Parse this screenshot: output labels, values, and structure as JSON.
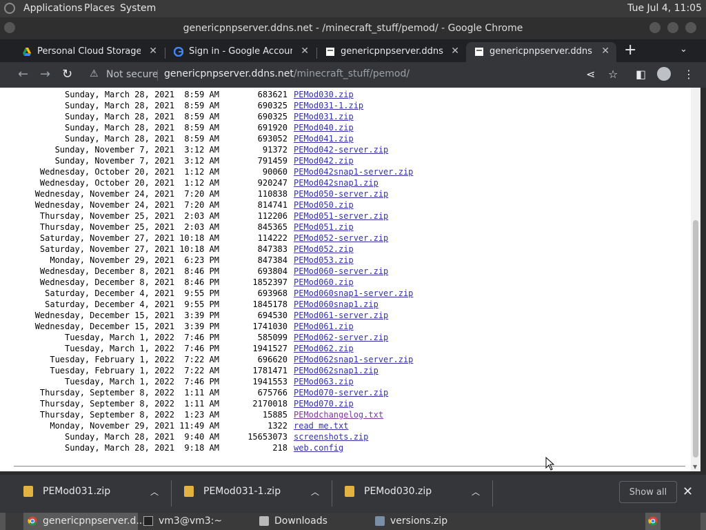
{
  "desktop": {
    "menus": [
      "Applications",
      "Places",
      "System"
    ],
    "clock": "Tue Jul  4, 11:05"
  },
  "window": {
    "title": "genericpnpserver.ddns.net - /minecraft_stuff/pemod/ - Google Chrome"
  },
  "tabs": [
    {
      "label": "Personal Cloud Storage & F",
      "icon": "google-drive-icon"
    },
    {
      "label": "Sign in - Google Accounts",
      "icon": "google-icon"
    },
    {
      "label": "genericpnpserver.ddns.net/",
      "icon": "page-icon"
    },
    {
      "label": "genericpnpserver.ddns.net/",
      "icon": "page-icon"
    }
  ],
  "toolbar": {
    "security_label": "Not secure",
    "url_host": "genericpnpserver.ddns.net",
    "url_path": "/minecraft_stuff/pemod/"
  },
  "listing": [
    {
      "date": "Sunday, March 28, 2021  8:59 AM",
      "size": "683621",
      "name": "PEMod030.zip"
    },
    {
      "date": "Sunday, March 28, 2021  8:59 AM",
      "size": "690325",
      "name": "PEMod031-1.zip"
    },
    {
      "date": "Sunday, March 28, 2021  8:59 AM",
      "size": "690325",
      "name": "PEMod031.zip"
    },
    {
      "date": "Sunday, March 28, 2021  8:59 AM",
      "size": "691920",
      "name": "PEMod040.zip"
    },
    {
      "date": "Sunday, March 28, 2021  8:59 AM",
      "size": "693052",
      "name": "PEMod041.zip"
    },
    {
      "date": "Sunday, November 7, 2021  3:12 AM",
      "size": "91372",
      "name": "PEMod042-server.zip"
    },
    {
      "date": "Sunday, November 7, 2021  3:12 AM",
      "size": "791459",
      "name": "PEMod042.zip"
    },
    {
      "date": "Wednesday, October 20, 2021  1:12 AM",
      "size": "90060",
      "name": "PEMod042snap1-server.zip"
    },
    {
      "date": "Wednesday, October 20, 2021  1:12 AM",
      "size": "920247",
      "name": "PEMod042snap1.zip"
    },
    {
      "date": "Wednesday, November 24, 2021  7:20 AM",
      "size": "110838",
      "name": "PEMod050-server.zip"
    },
    {
      "date": "Wednesday, November 24, 2021  7:20 AM",
      "size": "814741",
      "name": "PEMod050.zip"
    },
    {
      "date": "Thursday, November 25, 2021  2:03 AM",
      "size": "112206",
      "name": "PEMod051-server.zip"
    },
    {
      "date": "Thursday, November 25, 2021  2:03 AM",
      "size": "845365",
      "name": "PEMod051.zip"
    },
    {
      "date": "Saturday, November 27, 2021 10:18 AM",
      "size": "114222",
      "name": "PEMod052-server.zip"
    },
    {
      "date": "Saturday, November 27, 2021 10:18 AM",
      "size": "847383",
      "name": "PEMod052.zip"
    },
    {
      "date": "Monday, November 29, 2021  6:23 PM",
      "size": "847384",
      "name": "PEMod053.zip"
    },
    {
      "date": "Wednesday, December 8, 2021  8:46 PM",
      "size": "693804",
      "name": "PEMod060-server.zip"
    },
    {
      "date": "Wednesday, December 8, 2021  8:46 PM",
      "size": "1852397",
      "name": "PEMod060.zip"
    },
    {
      "date": "Saturday, December 4, 2021  9:55 PM",
      "size": "693968",
      "name": "PEMod060snap1-server.zip"
    },
    {
      "date": "Saturday, December 4, 2021  9:55 PM",
      "size": "1845178",
      "name": "PEMod060snap1.zip"
    },
    {
      "date": "Wednesday, December 15, 2021  3:39 PM",
      "size": "694530",
      "name": "PEMod061-server.zip"
    },
    {
      "date": "Wednesday, December 15, 2021  3:39 PM",
      "size": "1741030",
      "name": "PEMod061.zip"
    },
    {
      "date": "Tuesday, March 1, 2022  7:46 PM",
      "size": "585099",
      "name": "PEMod062-server.zip"
    },
    {
      "date": "Tuesday, March 1, 2022  7:46 PM",
      "size": "1941527",
      "name": "PEMod062.zip"
    },
    {
      "date": "Tuesday, February 1, 2022  7:22 AM",
      "size": "696620",
      "name": "PEMod062snap1-server.zip"
    },
    {
      "date": "Tuesday, February 1, 2022  7:22 AM",
      "size": "1781471",
      "name": "PEMod062snap1.zip"
    },
    {
      "date": "Tuesday, March 1, 2022  7:46 PM",
      "size": "1941553",
      "name": "PEMod063.zip"
    },
    {
      "date": "Thursday, September 8, 2022  1:11 AM",
      "size": "675766",
      "name": "PEMod070-server.zip"
    },
    {
      "date": "Thursday, September 8, 2022  1:11 AM",
      "size": "2170018",
      "name": "PEMod070.zip"
    },
    {
      "date": "Thursday, September 8, 2022  1:23 AM",
      "size": "15885",
      "name": "PEModchangelog.txt",
      "visited": true
    },
    {
      "date": "Monday, November 29, 2021 11:49 AM",
      "size": "1322",
      "name": "read me.txt"
    },
    {
      "date": "Sunday, March 28, 2021  9:40 AM",
      "size": "15653073",
      "name": "screenshots.zip"
    },
    {
      "date": "Sunday, March 28, 2021  9:18 AM",
      "size": "218",
      "name": "web.config"
    }
  ],
  "downloads": {
    "items": [
      "PEMod031.zip",
      "PEMod031-1.zip",
      "PEMod030.zip"
    ],
    "show_all_label": "Show all"
  },
  "taskbar": [
    {
      "label": "genericpnpserver.d...",
      "icon": "chrome-icon",
      "active": true
    },
    {
      "label": "vm3@vm3:~",
      "icon": "terminal-icon"
    },
    {
      "label": "Downloads",
      "icon": "folder-icon"
    },
    {
      "label": "versions.zip",
      "icon": "archive-icon"
    }
  ],
  "colors": {
    "link": "#3232a8",
    "visited_link": "#7a3a9a",
    "chrome_dark": "#35363a"
  }
}
